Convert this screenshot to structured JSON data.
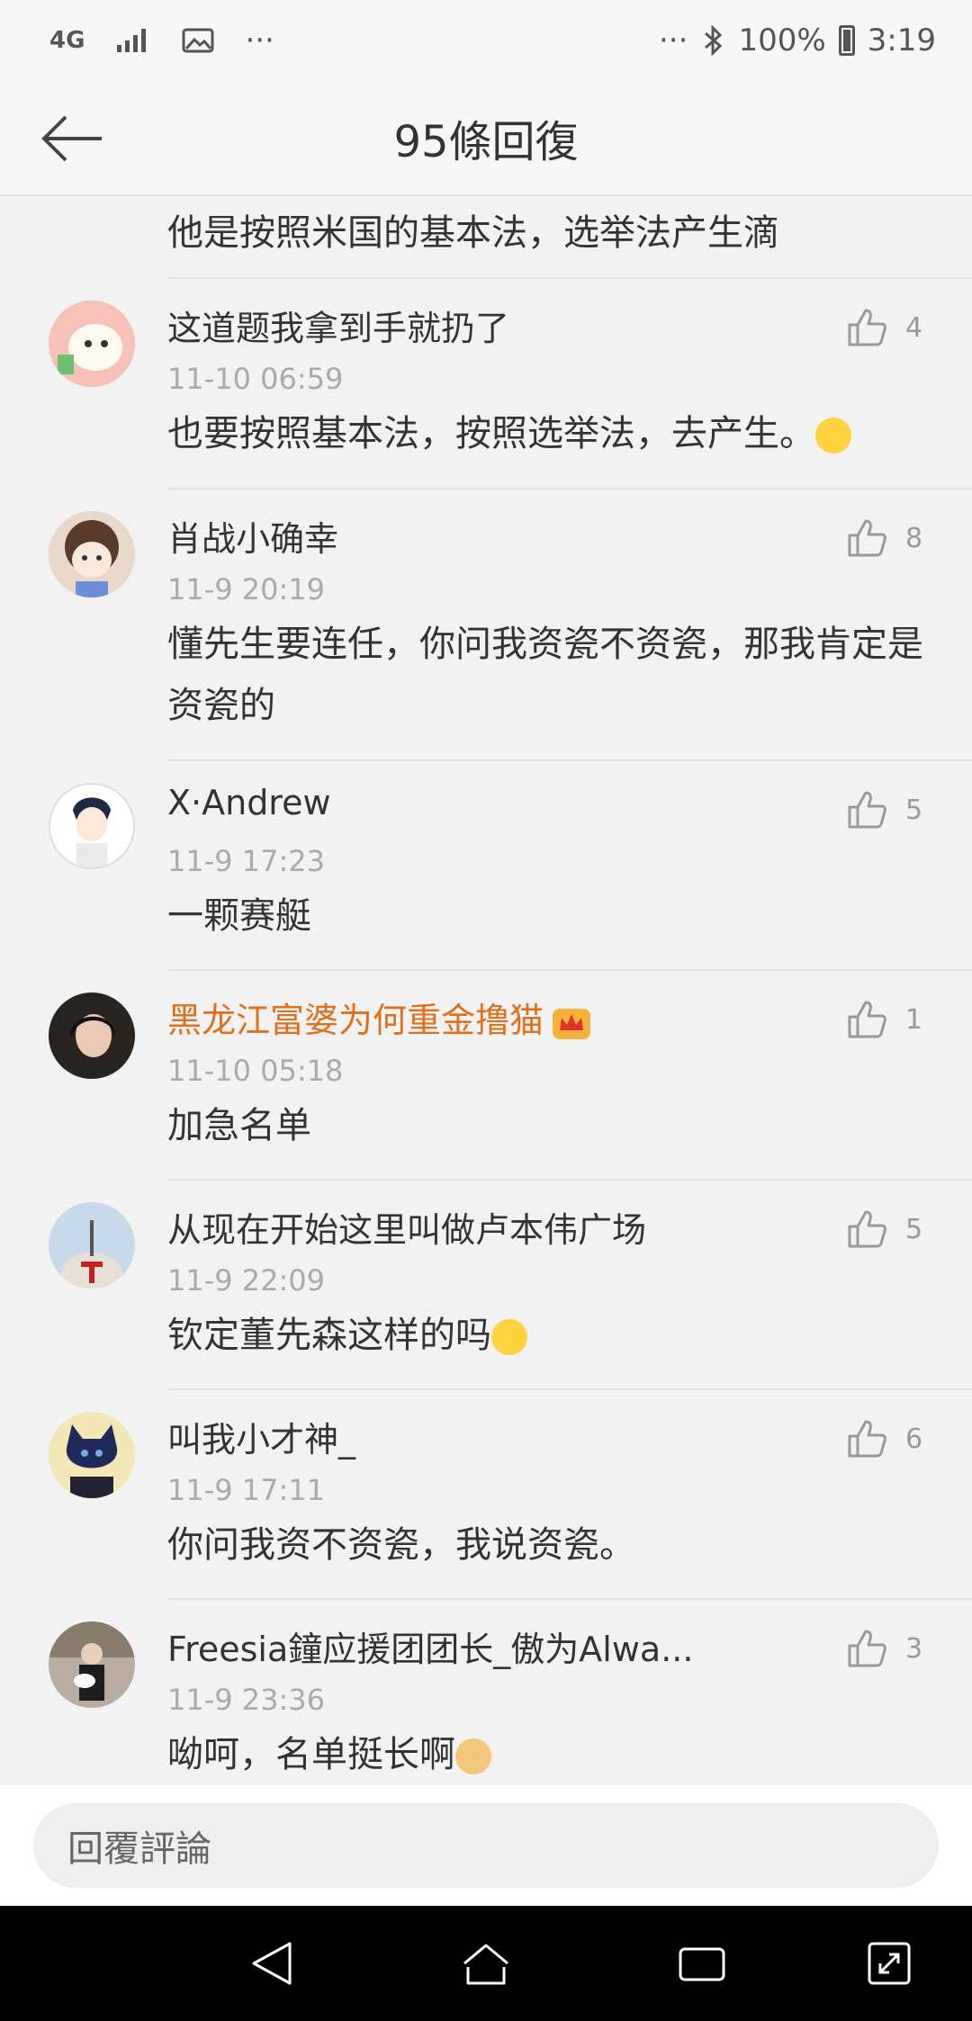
{
  "status": {
    "network": "4G",
    "more": "···",
    "more_right": "···",
    "battery": "100%",
    "time": "3:19"
  },
  "header": {
    "title": "95條回復"
  },
  "partial_text": "他是按照米国的基本法，选举法产生滴",
  "comments": [
    {
      "name": "这道题我拿到手就扔了",
      "time": "11-10 06:59",
      "text": "也要按照基本法，按照选举法，去产生。",
      "likes": "4"
    },
    {
      "name": "肖战小确幸",
      "time": "11-9 20:19",
      "text": "懂先生要连任，你问我资瓷不资瓷，那我肯定是资瓷的",
      "likes": "8"
    },
    {
      "name": "X·Andrew",
      "time": "11-9 17:23",
      "text": "一颗赛艇",
      "likes": "5"
    },
    {
      "name": "黑龙江富婆为何重金撸猫",
      "time": "11-10 05:18",
      "text": "加急名单",
      "likes": "1"
    },
    {
      "name": "从现在开始这里叫做卢本伟广场",
      "time": "11-9 22:09",
      "text": "钦定董先森这样的吗",
      "likes": "5"
    },
    {
      "name": "叫我小才神_",
      "time": "11-9 17:11",
      "text": "你问我资不资瓷，我说资瓷。",
      "likes": "6"
    },
    {
      "name": "Freesia鐘应援团团长_傲为Alwa...",
      "time": "11-9 23:36",
      "text": "呦呵，名单挺长啊",
      "likes": "3"
    }
  ],
  "reply": {
    "placeholder": "回覆評論"
  },
  "colors": {
    "vip_name": "#e0701a",
    "timestamp": "#aaaaaa",
    "emoji": "#ffd23f"
  }
}
